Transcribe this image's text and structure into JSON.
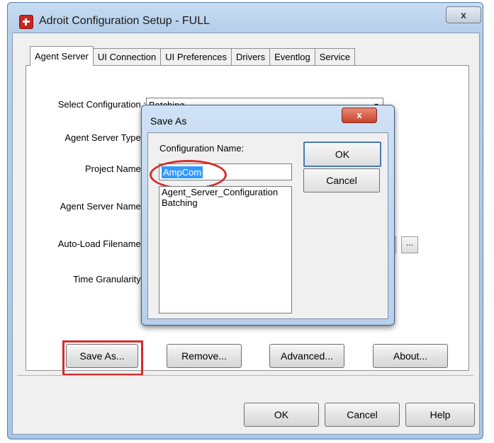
{
  "window": {
    "title": "Adroit Configuration Setup - FULL",
    "close_glyph": "x"
  },
  "tabs": [
    {
      "label": "Agent Server"
    },
    {
      "label": "UI Connection"
    },
    {
      "label": "UI Preferences"
    },
    {
      "label": "Drivers"
    },
    {
      "label": "Eventlog"
    },
    {
      "label": "Service"
    }
  ],
  "form": {
    "select_configuration_label": "Select Configuration :",
    "select_configuration_value": "Batching",
    "agent_server_type_label": "Agent Server Type :",
    "project_name_label": "Project Name :",
    "agent_server_name_label": "Agent Server Name :",
    "auto_load_filename_label": "Auto-Load Filename :",
    "time_granularity_label": "Time Granularity :",
    "browse_label": "..."
  },
  "actions": {
    "save_as": "Save As...",
    "remove": "Remove...",
    "advanced": "Advanced...",
    "about": "About..."
  },
  "footer": {
    "ok": "OK",
    "cancel": "Cancel",
    "help": "Help"
  },
  "dialog": {
    "title": "Save As",
    "close_glyph": "x",
    "name_label": "Configuration Name:",
    "name_value": "AmpCom",
    "list": [
      "Agent_Server_Configuration",
      "Batching"
    ],
    "ok": "OK",
    "cancel": "Cancel"
  },
  "colors": {
    "highlight": "#d62b2b",
    "selection": "#3399ff"
  }
}
